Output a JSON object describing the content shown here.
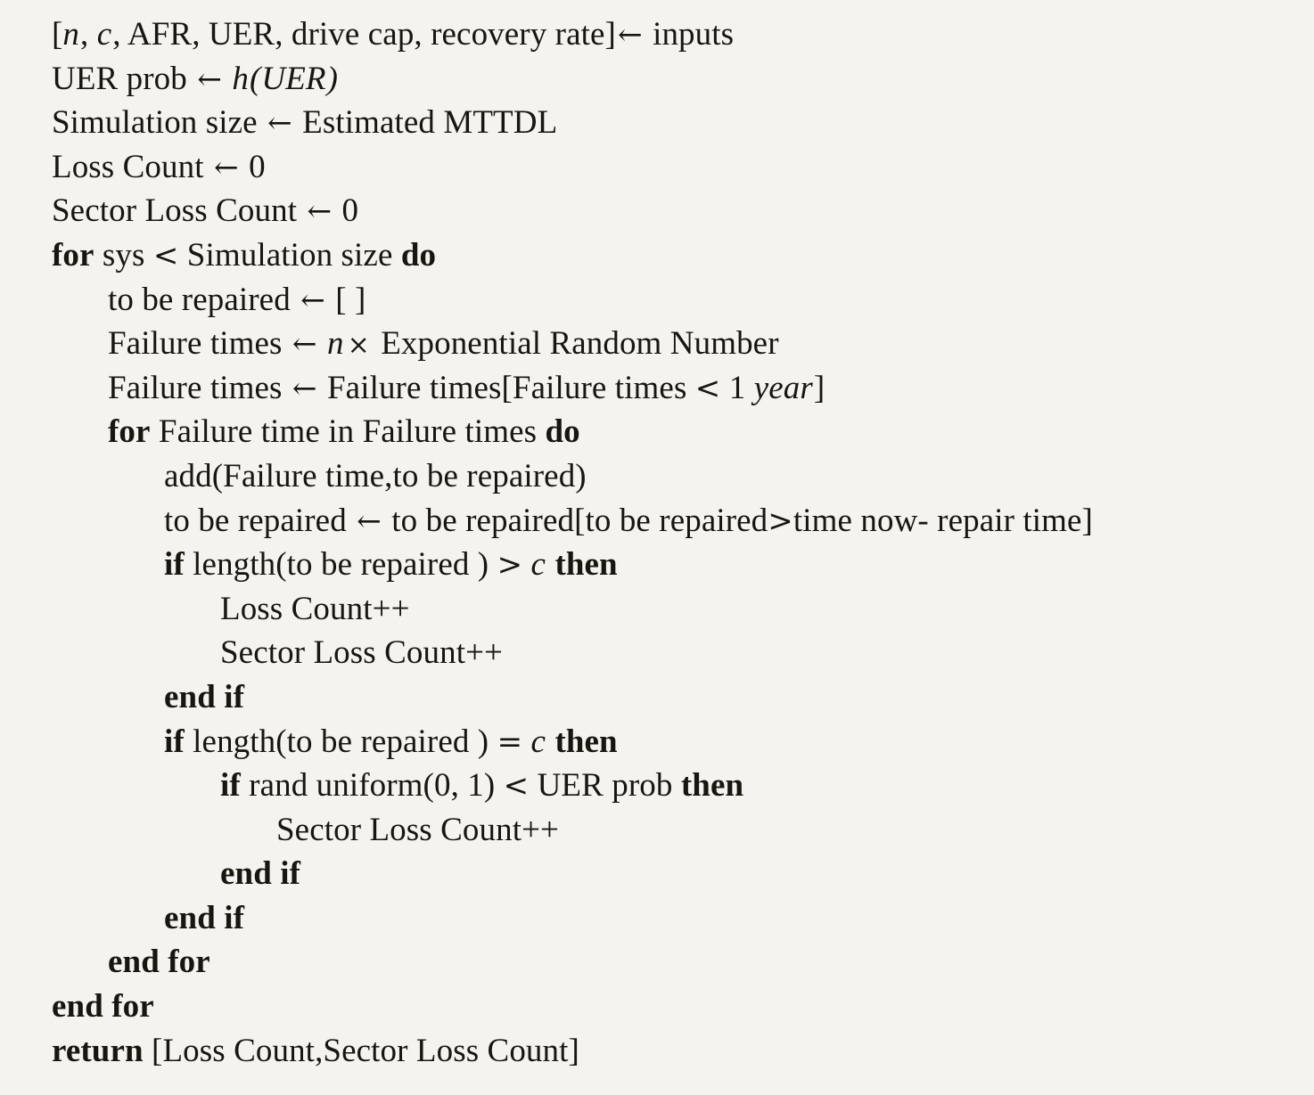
{
  "document": {
    "type": "algorithm-pseudocode",
    "title": "",
    "background_color": "#f4f3ef",
    "text_color": "#17160f",
    "font_style": "serif-latex"
  },
  "lines": [
    {
      "id": "line-inputs",
      "indent": 0,
      "text": "[n, c, AFR, UER, drive cap, recovery rate] ← inputs",
      "segments": [
        {
          "t": "[",
          "s": "plain"
        },
        {
          "t": "n",
          "s": "mathit"
        },
        {
          "t": ", ",
          "s": "plain"
        },
        {
          "t": "c",
          "s": "mathit"
        },
        {
          "t": ", AFR, UER, drive cap, recovery rate]",
          "s": "plain"
        },
        {
          "t": "←",
          "s": "arrow"
        },
        {
          "t": " inputs",
          "s": "plain"
        }
      ]
    },
    {
      "id": "line-uer-prob",
      "indent": 0,
      "text": "UER prob ← h(UER)",
      "segments": [
        {
          "t": "UER prob ",
          "s": "plain"
        },
        {
          "t": "←",
          "s": "arrow"
        },
        {
          "t": " ",
          "s": "plain"
        },
        {
          "t": "h",
          "s": "mathit"
        },
        {
          "t": "(",
          "s": "mathit"
        },
        {
          "t": "UER",
          "s": "mathit"
        },
        {
          "t": ")",
          "s": "mathit"
        }
      ]
    },
    {
      "id": "line-sim-size",
      "indent": 0,
      "text": "Simulation size ← Estimated MTTDL",
      "segments": [
        {
          "t": "Simulation size ",
          "s": "plain"
        },
        {
          "t": "←",
          "s": "arrow"
        },
        {
          "t": " Estimated MTTDL",
          "s": "plain"
        }
      ]
    },
    {
      "id": "line-loss-count-init",
      "indent": 0,
      "text": "Loss Count ← 0",
      "segments": [
        {
          "t": "Loss Count ",
          "s": "plain"
        },
        {
          "t": "←",
          "s": "arrow"
        },
        {
          "t": " 0",
          "s": "plain"
        }
      ]
    },
    {
      "id": "line-sector-loss-count-init",
      "indent": 0,
      "text": "Sector Loss Count ← 0",
      "segments": [
        {
          "t": "Sector Loss Count ",
          "s": "plain"
        },
        {
          "t": "←",
          "s": "arrow"
        },
        {
          "t": " 0",
          "s": "plain"
        }
      ]
    },
    {
      "id": "line-for-sys",
      "indent": 0,
      "text": "for sys < Simulation size do",
      "segments": [
        {
          "t": "for",
          "s": "kw"
        },
        {
          "t": " sys ",
          "s": "plain"
        },
        {
          "t": "<",
          "s": "op"
        },
        {
          "t": " Simulation size ",
          "s": "plain"
        },
        {
          "t": "do",
          "s": "kw"
        }
      ]
    },
    {
      "id": "line-to-be-repaired-init",
      "indent": 1,
      "text": "to be repaired ← [ ]",
      "segments": [
        {
          "t": "to be repaired ",
          "s": "plain"
        },
        {
          "t": "←",
          "s": "arrow"
        },
        {
          "t": " [ ]",
          "s": "plain"
        }
      ]
    },
    {
      "id": "line-failure-times-gen",
      "indent": 1,
      "text": "Failure times ← n × Exponential Random Number",
      "segments": [
        {
          "t": "Failure times ",
          "s": "plain"
        },
        {
          "t": "←",
          "s": "arrow"
        },
        {
          "t": " ",
          "s": "plain"
        },
        {
          "t": "n",
          "s": "mathit"
        },
        {
          "t": "×",
          "s": "times"
        },
        {
          "t": " Exponential Random Number",
          "s": "plain"
        }
      ]
    },
    {
      "id": "line-failure-times-filter",
      "indent": 1,
      "text": "Failure times ← Failure times[Failure times < 1 year]",
      "segments": [
        {
          "t": "Failure times ",
          "s": "plain"
        },
        {
          "t": "←",
          "s": "arrow"
        },
        {
          "t": " Failure times[Failure times ",
          "s": "plain"
        },
        {
          "t": "<",
          "s": "op"
        },
        {
          "t": " 1 ",
          "s": "plain"
        },
        {
          "t": "year",
          "s": "mathit"
        },
        {
          "t": "]",
          "s": "plain"
        }
      ]
    },
    {
      "id": "line-for-failure-time",
      "indent": 1,
      "text": "for Failure time in Failure times do",
      "segments": [
        {
          "t": "for",
          "s": "kw"
        },
        {
          "t": " Failure time in Failure times ",
          "s": "plain"
        },
        {
          "t": "do",
          "s": "kw"
        }
      ]
    },
    {
      "id": "line-add-failure-time",
      "indent": 2,
      "text": "add(Failure time,to be repaired)",
      "segments": [
        {
          "t": "add(Failure time,to be repaired)",
          "s": "plain"
        }
      ]
    },
    {
      "id": "line-to-be-repaired-filter",
      "indent": 2,
      "text": "to be repaired ← to be repaired[to be repaired>time now- repair time]",
      "segments": [
        {
          "t": "to be repaired ",
          "s": "plain"
        },
        {
          "t": "←",
          "s": "arrow"
        },
        {
          "t": " to be repaired[to be repaired",
          "s": "plain"
        },
        {
          "t": ">",
          "s": "op"
        },
        {
          "t": "time now- repair time]",
          "s": "plain"
        }
      ]
    },
    {
      "id": "line-if-length-gt-c",
      "indent": 2,
      "text": "if length(to be repaired ) > c  then",
      "segments": [
        {
          "t": "if",
          "s": "kw"
        },
        {
          "t": " length(to be repaired ) ",
          "s": "plain"
        },
        {
          "t": ">",
          "s": "op"
        },
        {
          "t": " ",
          "s": "plain"
        },
        {
          "t": "c",
          "s": "mathit"
        },
        {
          "t": "  ",
          "s": "plain"
        },
        {
          "t": "then",
          "s": "kw"
        }
      ]
    },
    {
      "id": "line-loss-count-inc",
      "indent": 3,
      "text": "Loss Count++",
      "segments": [
        {
          "t": "Loss Count++",
          "s": "plain"
        }
      ]
    },
    {
      "id": "line-sector-loss-count-inc-1",
      "indent": 3,
      "text": "Sector Loss Count++",
      "segments": [
        {
          "t": "Sector Loss Count++",
          "s": "plain"
        }
      ]
    },
    {
      "id": "line-end-if-1",
      "indent": 2,
      "text": "end if",
      "segments": [
        {
          "t": "end if",
          "s": "kw"
        }
      ]
    },
    {
      "id": "line-if-length-eq-c",
      "indent": 2,
      "text": "if length(to be repaired ) = c  then",
      "segments": [
        {
          "t": "if",
          "s": "kw"
        },
        {
          "t": " length(to be repaired ) ",
          "s": "plain"
        },
        {
          "t": "=",
          "s": "op"
        },
        {
          "t": " ",
          "s": "plain"
        },
        {
          "t": "c",
          "s": "mathit"
        },
        {
          "t": "  ",
          "s": "plain"
        },
        {
          "t": "then",
          "s": "kw"
        }
      ]
    },
    {
      "id": "line-if-rand-uniform",
      "indent": 3,
      "text": "if rand uniform(0, 1) < UER prob  then",
      "segments": [
        {
          "t": "if",
          "s": "kw"
        },
        {
          "t": " rand uniform(0",
          "s": "plain"
        },
        {
          "t": ", ",
          "s": "plain"
        },
        {
          "t": "1) ",
          "s": "plain"
        },
        {
          "t": "<",
          "s": "op"
        },
        {
          "t": " UER prob  ",
          "s": "plain"
        },
        {
          "t": "then",
          "s": "kw"
        }
      ]
    },
    {
      "id": "line-sector-loss-count-inc-2",
      "indent": 4,
      "text": "Sector Loss Count++",
      "segments": [
        {
          "t": "Sector Loss Count++",
          "s": "plain"
        }
      ]
    },
    {
      "id": "line-end-if-2",
      "indent": 3,
      "text": "end if",
      "segments": [
        {
          "t": "end if",
          "s": "kw"
        }
      ]
    },
    {
      "id": "line-end-if-3",
      "indent": 2,
      "text": "end if",
      "segments": [
        {
          "t": "end if",
          "s": "kw"
        }
      ]
    },
    {
      "id": "line-end-for-inner",
      "indent": 1,
      "text": "end for",
      "segments": [
        {
          "t": "end for",
          "s": "kw"
        }
      ]
    },
    {
      "id": "line-end-for-outer",
      "indent": 0,
      "text": "end for",
      "segments": [
        {
          "t": "end for",
          "s": "kw"
        }
      ]
    },
    {
      "id": "line-return",
      "indent": 0,
      "text": "return [Loss Count,Sector Loss Count]",
      "segments": [
        {
          "t": "return",
          "s": "kw"
        },
        {
          "t": " [Loss Count,Sector Loss Count]",
          "s": "plain"
        }
      ]
    }
  ]
}
